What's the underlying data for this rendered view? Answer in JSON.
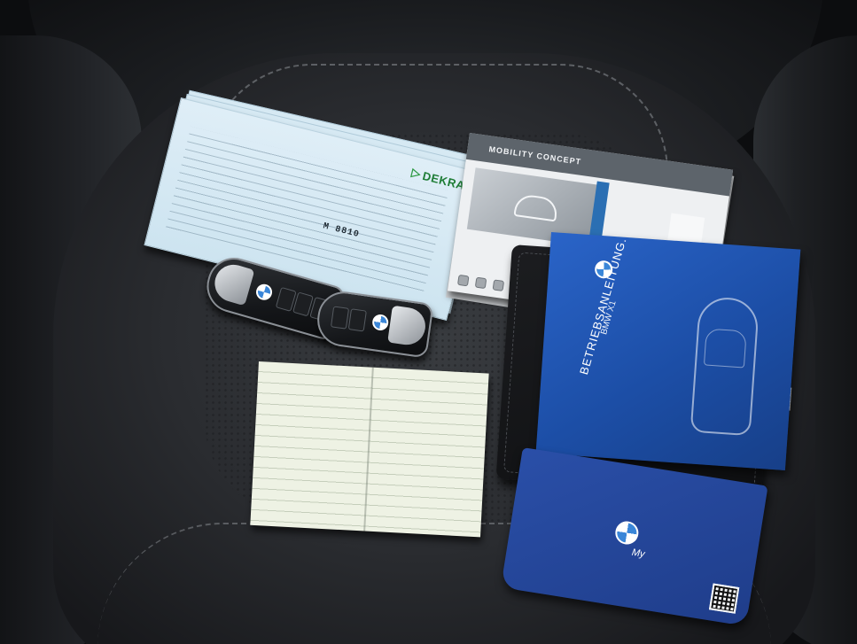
{
  "scene": {
    "description_labels": {
      "report_brand": "DEKRA",
      "report_plate": "M 8810",
      "booklet_title": "MOBILITY CONCEPT",
      "manual_title": "BETRIEBSANLEITUNG.",
      "manual_model": "BMW X1",
      "leaflet_brand": "My"
    }
  },
  "colors": {
    "seat": "#2a2c30",
    "report_paper": "#cde4f0",
    "manual_blue": "#1c4ea6",
    "registration_paper": "#eef2e4",
    "dekra_green": "#2e9a44"
  },
  "icons": {
    "report_logo": "dekra-arrow-icon",
    "brand_logo": "bmw-roundel-icon",
    "leaflet_code": "qr-code-icon"
  }
}
